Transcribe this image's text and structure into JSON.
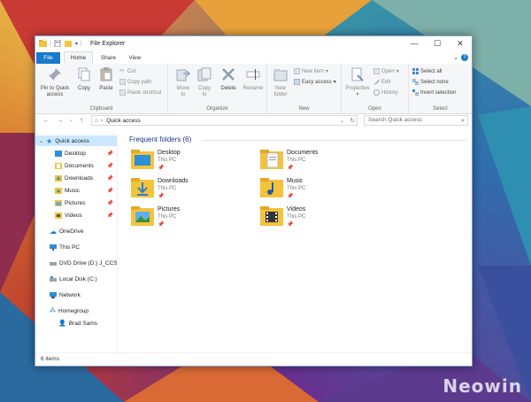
{
  "window": {
    "title": "File Explorer",
    "accent": "#1979ca"
  },
  "tabs": {
    "file": "File",
    "home": "Home",
    "share": "Share",
    "view": "View"
  },
  "ribbon": {
    "clipboard": {
      "label": "Clipboard",
      "pin": "Pin to Quick access",
      "pin_line1": "Pin to Quick",
      "pin_line2": "access",
      "copy": "Copy",
      "paste": "Paste",
      "cut": "Cut",
      "copy_path": "Copy path",
      "paste_shortcut": "Paste shortcut"
    },
    "organize": {
      "label": "Organize",
      "move_to_1": "Move",
      "move_to_2": "to",
      "copy_to_1": "Copy",
      "copy_to_2": "to",
      "delete": "Delete",
      "rename": "Rename"
    },
    "new": {
      "label": "New",
      "new_folder_1": "New",
      "new_folder_2": "folder",
      "new_item": "New item",
      "easy_access": "Easy access"
    },
    "open": {
      "label": "Open",
      "properties": "Properties",
      "open": "Open",
      "edit": "Edit",
      "history": "History"
    },
    "select": {
      "label": "Select",
      "select_all": "Select all",
      "select_none": "Select none",
      "invert": "Invert selection"
    }
  },
  "address": {
    "path": "Quick access",
    "search_placeholder": "Search Quick access"
  },
  "nav": {
    "quick_access": "Quick access",
    "pinned": [
      {
        "label": "Desktop"
      },
      {
        "label": "Documents"
      },
      {
        "label": "Downloads"
      },
      {
        "label": "Music"
      },
      {
        "label": "Pictures"
      },
      {
        "label": "Videos"
      }
    ],
    "onedrive": "OneDrive",
    "this_pc": "This PC",
    "dvd": "DVD Drive (D:) J_CCS",
    "local_disk": "Local Disk (C:)",
    "network": "Network",
    "homegroup": "Homegroup",
    "user": "Brad Sams"
  },
  "content": {
    "group_title": "Frequent folders (6)",
    "folders": [
      {
        "name": "Desktop",
        "location": "This PC"
      },
      {
        "name": "Documents",
        "location": "This PC"
      },
      {
        "name": "Downloads",
        "location": "This PC"
      },
      {
        "name": "Music",
        "location": "This PC"
      },
      {
        "name": "Pictures",
        "location": "This PC"
      },
      {
        "name": "Videos",
        "location": "This PC"
      }
    ]
  },
  "status": {
    "count": "6 items"
  },
  "watermark": "Neowin"
}
